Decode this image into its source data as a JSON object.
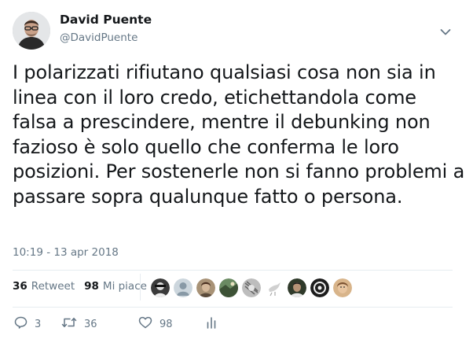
{
  "user": {
    "name": "David Puente",
    "handle": "@DavidPuente"
  },
  "tweet": {
    "text": "I polarizzati rifiutano qualsiasi cosa non sia in linea con il loro credo, etichettandola come falsa a prescindere, mentre il debunking non fazioso è solo quello che conferma le loro posizioni. Per sostenerle non si fanno problemi a passare sopra qualunque fatto o persona.",
    "timestamp": "10:19 - 13 apr 2018"
  },
  "stats": {
    "retweets_count": "36",
    "retweets_label": "Retweet",
    "likes_count": "98",
    "likes_label": "Mi piace"
  },
  "likers": [
    {
      "icon": "avatar-glasses-icon",
      "color": "#3a3a3a"
    },
    {
      "icon": "avatar-default-icon",
      "color": "#aab8c2"
    },
    {
      "icon": "avatar-photo-icon",
      "color": "#8a7a60"
    },
    {
      "icon": "avatar-landscape-icon",
      "color": "#4f6a4a"
    },
    {
      "icon": "avatar-pattern-icon",
      "color": "#9a9a9a"
    },
    {
      "icon": "avatar-bird-icon",
      "color": "#ffffff"
    },
    {
      "icon": "avatar-portrait-icon",
      "color": "#2f3a2a"
    },
    {
      "icon": "avatar-logo-icon",
      "color": "#1c1c1c"
    },
    {
      "icon": "avatar-face-icon",
      "color": "#c99a6a"
    }
  ],
  "actions": {
    "reply_count": "3",
    "retweet_count": "36",
    "like_count": "98"
  },
  "colors": {
    "text": "#14171a",
    "secondary": "#657786",
    "divider": "#e6ecf0"
  }
}
